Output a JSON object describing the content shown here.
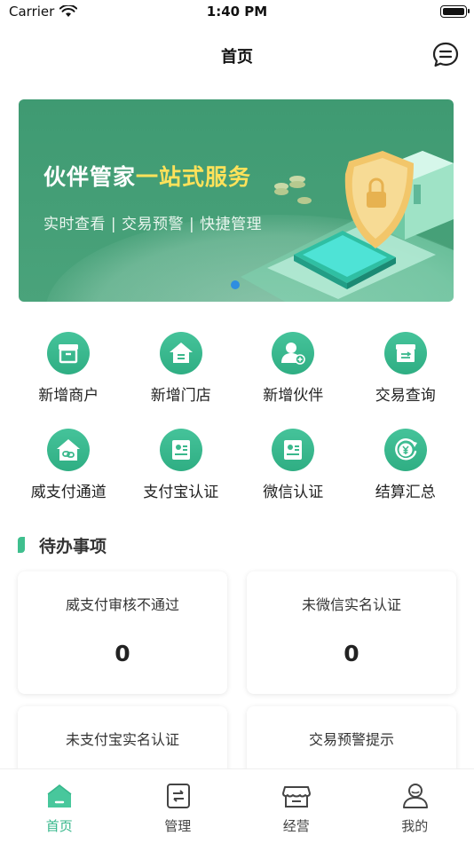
{
  "status_bar": {
    "carrier": "Carrier",
    "time": "1:40 PM"
  },
  "nav": {
    "title": "首页"
  },
  "banner": {
    "title_main": "伙伴管家",
    "title_highlight": "一站式服务",
    "subtitle": "实时查看 | 交易预警 | 快捷管理"
  },
  "grid": {
    "row1": [
      {
        "label": "新增商户",
        "icon": "store-icon"
      },
      {
        "label": "新增门店",
        "icon": "house-icon"
      },
      {
        "label": "新增伙伴",
        "icon": "add-person-icon"
      },
      {
        "label": "交易查询",
        "icon": "transfer-box-icon"
      }
    ],
    "row2": [
      {
        "label": "威支付通道",
        "icon": "link-house-icon"
      },
      {
        "label": "支付宝认证",
        "icon": "id-card-icon"
      },
      {
        "label": "微信认证",
        "icon": "id-card-icon"
      },
      {
        "label": "结算汇总",
        "icon": "yuan-cycle-icon"
      }
    ]
  },
  "todo": {
    "title": "待办事项",
    "cards": [
      {
        "label": "威支付审核不通过",
        "value": "0"
      },
      {
        "label": "未微信实名认证",
        "value": "0"
      },
      {
        "label": "未支付宝实名认证",
        "value": ""
      },
      {
        "label": "交易预警提示",
        "value": ""
      }
    ]
  },
  "tabs": [
    {
      "label": "首页",
      "active": true,
      "icon": "home-icon"
    },
    {
      "label": "管理",
      "active": false,
      "icon": "manage-icon"
    },
    {
      "label": "经营",
      "active": false,
      "icon": "shop-icon"
    },
    {
      "label": "我的",
      "active": false,
      "icon": "user-icon"
    }
  ],
  "colors": {
    "accent": "#36b78b",
    "banner": "#3f9a72",
    "highlight": "#ffe25a"
  }
}
